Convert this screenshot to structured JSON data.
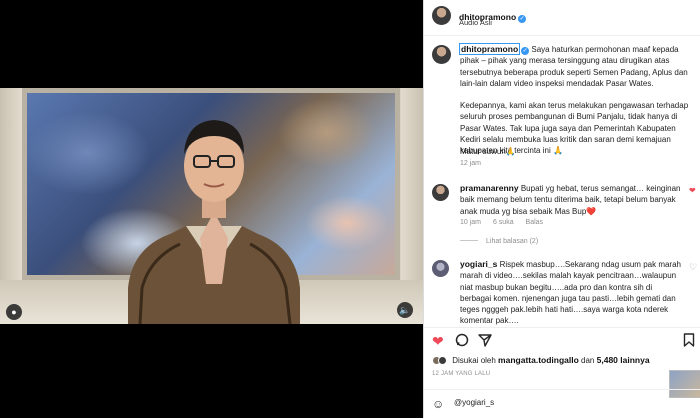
{
  "post": {
    "username": "dhitopramono",
    "audio_label": "Audio Asli",
    "caption_p1": "Saya haturkan permohonan maaf kepada pihak – pihak yang merasa tersinggung atau dirugikan atas tersebutnya beberapa produk seperti Semen Padang, Aplus dan lain-lain dalam video inspeksi mendadak Pasar Wates.",
    "caption_p2": "Kedepannya, kami akan terus melakukan pengawasan terhadap seluruh proses pembangunan di Bumi Panjalu, tidak hanya di Pasar Wates. Tak lupa juga saya dan Pemerintah Kabupaten Kediri selalu membuka luas kritik dan saran demi kemajuan kabupaten kita tercinta ini 🙏",
    "caption_p3": "Matur suwun🙏",
    "caption_time": "12 jam"
  },
  "comments": [
    {
      "username": "pramanarenny",
      "text": "Bupati yg hebat, terus semangat… keinginan baik memang belum tentu diterima baik, tetapi belum banyak anak muda yg bisa sebaik Mas Bup❤️",
      "time": "10 jam",
      "likes": "6 suka",
      "reply": "Balas",
      "view_replies": "Lihat balasan (2)"
    },
    {
      "username": "yogiari_s",
      "text": "Rispek masbup….Sekarang ndag usum pak marah marah di video….sekilas malah kayak pencitraan…walaupun niat masbup bukan begitu…..ada pro dan kontra sih di berbagai komen. njenengan juga tau pasti…lebih gemati dan teges ngggeh pak.lebih hati hati….saya warga kota nderek komentar pak…."
    }
  ],
  "likes": {
    "prefix": "Disukai oleh",
    "user": "mangatta.todingallo",
    "conj": "dan",
    "count": "5,480 lainnya"
  },
  "posted_ago": "12 JAM YANG LALU",
  "comment_input": {
    "value": "@yogiari_s"
  },
  "icons": {
    "verified": "verified-badge-icon",
    "like": "heart-icon",
    "comment": "comment-bubble-icon",
    "share": "paper-plane-icon",
    "save": "bookmark-icon",
    "emoji": "smiley-icon",
    "sound": "speaker-icon",
    "tagged": "user-tag-icon"
  },
  "colors": {
    "verified": "#3897f0",
    "like": "#ed4956"
  }
}
